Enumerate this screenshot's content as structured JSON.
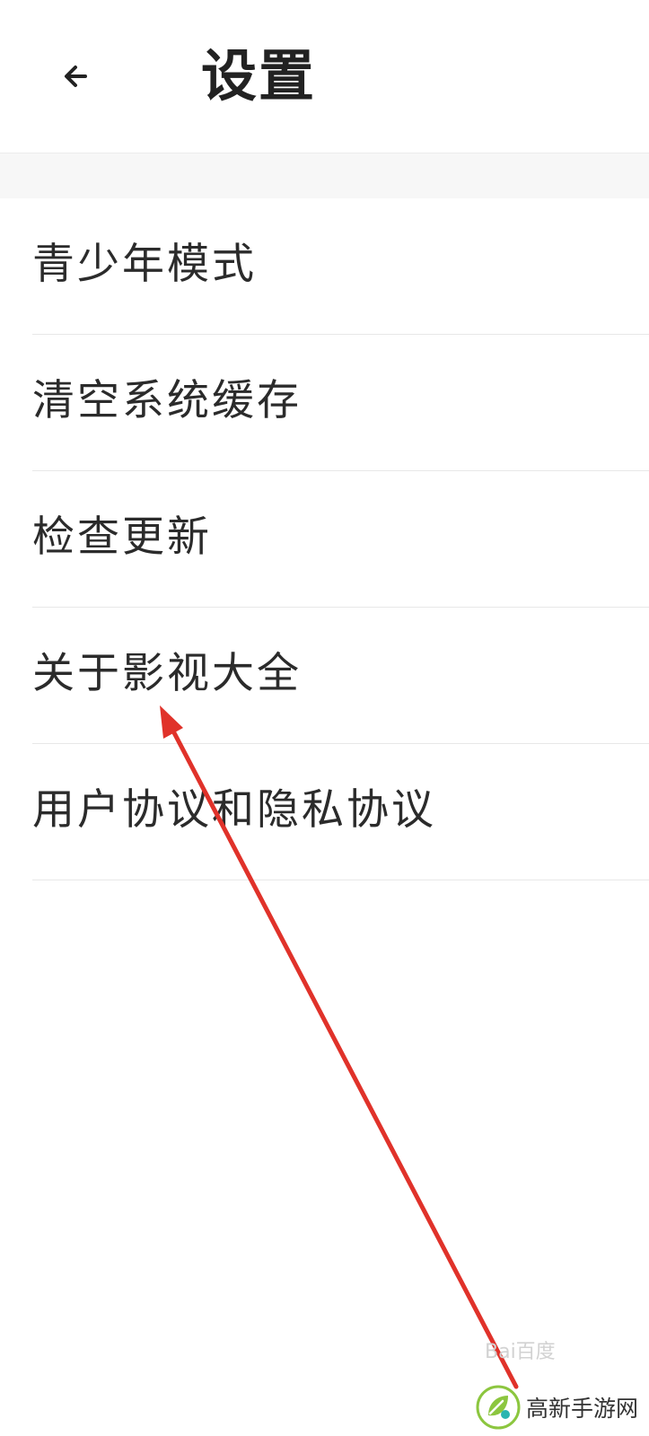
{
  "header": {
    "title": "设置",
    "back_icon": "arrow-left-icon"
  },
  "menu": {
    "items": [
      {
        "label": "青少年模式"
      },
      {
        "label": "清空系统缓存"
      },
      {
        "label": "检查更新"
      },
      {
        "label": "关于影视大全"
      },
      {
        "label": "用户协议和隐私协议"
      }
    ]
  },
  "annotation": {
    "arrow_color": "#e0322a"
  },
  "watermark": {
    "faint_text": "Bai百度",
    "site_name": "高新手游网",
    "logo_icon": "leaf-logo-icon"
  },
  "colors": {
    "background": "#ffffff",
    "section_gap": "#f7f7f7",
    "divider": "#e8e8e8",
    "text": "#2b2b2b"
  }
}
